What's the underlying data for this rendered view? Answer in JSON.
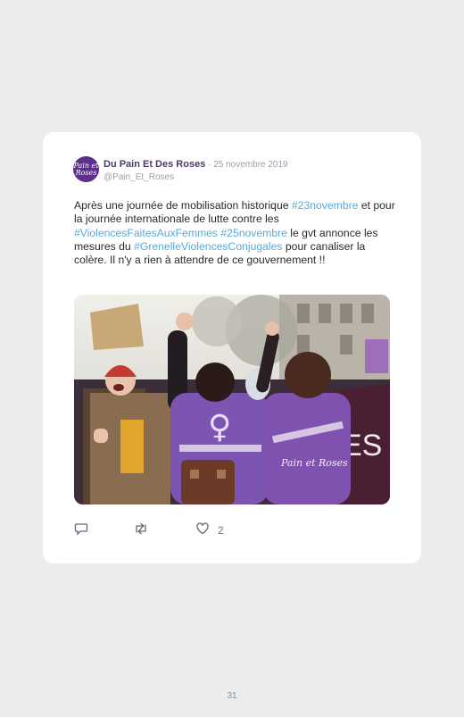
{
  "tweet": {
    "avatar_text": "Pain et Roses",
    "display_name": "Du Pain Et Des Roses",
    "separator": " · ",
    "date": "25 novembre 2019",
    "handle": "@Pain_Et_Roses",
    "text_parts": {
      "p1": "Après une journée de mobilisation historique ",
      "h1": "#23novembre",
      "p2": " et pour la journée internationale de lutte contre les ",
      "h2": "#ViolencesFaitesAuxFemmes",
      "p3": " ",
      "h3": "#25novembre",
      "p4": " le gvt annonce les mesures du ",
      "h4": "#GrenelleViolencesConjugales",
      "p5": " pour canaliser la colère. Il n'y a rien à attendre de ce gouvernement !!"
    },
    "photo_banner_text": "ES",
    "photo_vest_text": "Pain et Roses",
    "likes": "2"
  },
  "icons": {
    "reply": "reply-icon",
    "retweet": "retweet-icon",
    "like": "heart-icon"
  },
  "colors": {
    "accent_purple": "#6a3aa0",
    "hashtag": "#5aaad8",
    "background": "#ebecee"
  },
  "page": {
    "number": "31"
  }
}
